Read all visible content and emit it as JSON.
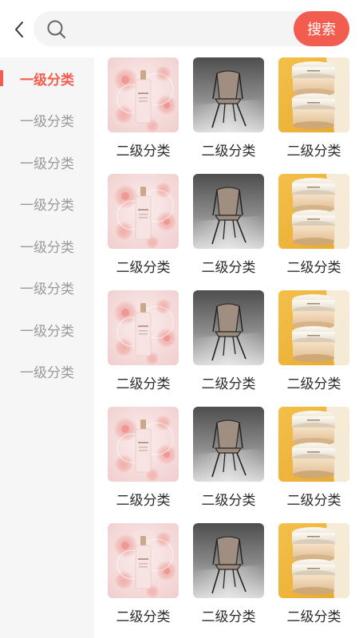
{
  "search": {
    "placeholder": "",
    "button_label": "搜索"
  },
  "icons": {
    "back": "chevron-left-icon",
    "search": "search-icon"
  },
  "colors": {
    "accent": "#f35d4f",
    "sidebar_bg": "#f6f6f6",
    "inactive_text": "#9a9a9a"
  },
  "sidebar": {
    "active_index": 0,
    "items": [
      {
        "label": "一级分类"
      },
      {
        "label": "一级分类"
      },
      {
        "label": "一级分类"
      },
      {
        "label": "一级分类"
      },
      {
        "label": "一级分类"
      },
      {
        "label": "一级分类"
      },
      {
        "label": "一级分类"
      },
      {
        "label": "一级分类"
      }
    ]
  },
  "grid": {
    "items": [
      {
        "label": "二级分类",
        "image": "perfume-roses"
      },
      {
        "label": "二级分类",
        "image": "chair"
      },
      {
        "label": "二级分类",
        "image": "cream-jars"
      },
      {
        "label": "二级分类",
        "image": "perfume-roses"
      },
      {
        "label": "二级分类",
        "image": "chair"
      },
      {
        "label": "二级分类",
        "image": "cream-jars"
      },
      {
        "label": "二级分类",
        "image": "perfume-roses"
      },
      {
        "label": "二级分类",
        "image": "chair"
      },
      {
        "label": "二级分类",
        "image": "cream-jars"
      },
      {
        "label": "二级分类",
        "image": "perfume-roses"
      },
      {
        "label": "二级分类",
        "image": "chair"
      },
      {
        "label": "二级分类",
        "image": "cream-jars"
      },
      {
        "label": "二级分类",
        "image": "perfume-roses"
      },
      {
        "label": "二级分类",
        "image": "chair"
      },
      {
        "label": "二级分类",
        "image": "cream-jars"
      }
    ]
  }
}
